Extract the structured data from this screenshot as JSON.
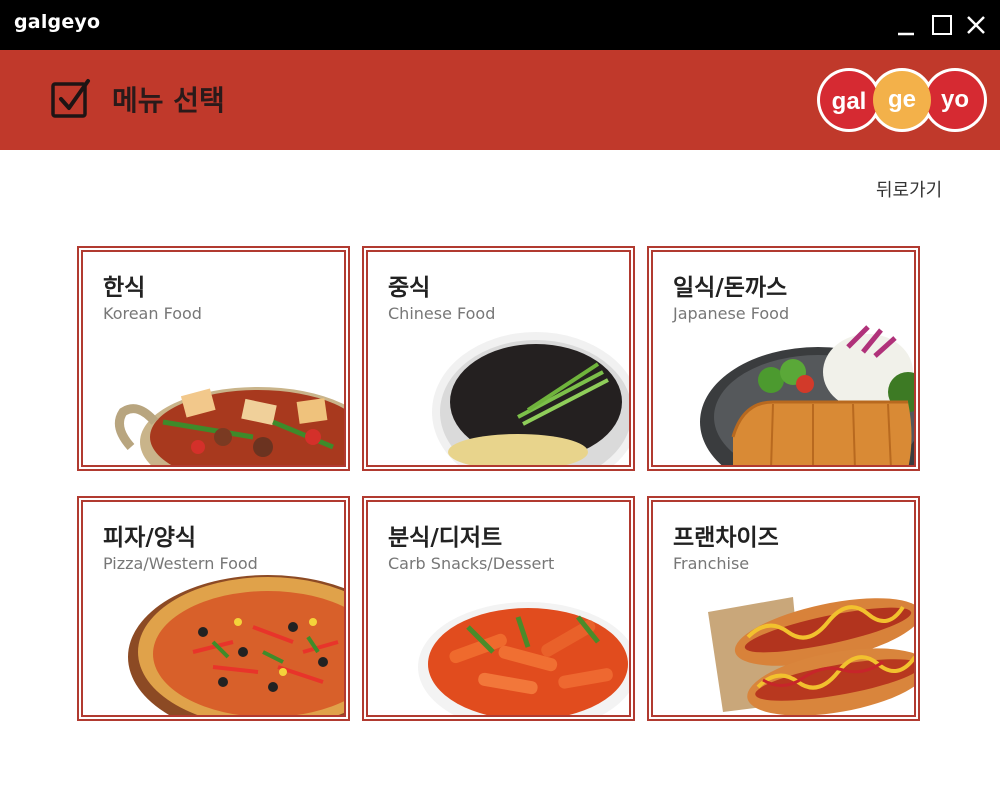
{
  "window": {
    "app_name": "galgeyo"
  },
  "header": {
    "title": "메뉴 선택",
    "logo": {
      "parts": [
        "gal",
        "ge",
        "yo"
      ]
    }
  },
  "nav": {
    "back_label": "뒤로가기"
  },
  "categories": [
    {
      "ko": "한식",
      "en": "Korean Food"
    },
    {
      "ko": "중식",
      "en": "Chinese Food"
    },
    {
      "ko": "일식/돈까스",
      "en": "Japanese Food"
    },
    {
      "ko": "피자/양식",
      "en": "Pizza/Western Food"
    },
    {
      "ko": "분식/디저트",
      "en": "Carb Snacks/Dessert"
    },
    {
      "ko": "프랜차이즈",
      "en": "Franchise"
    }
  ],
  "colors": {
    "header_bg": "#c0392b",
    "card_border": "#b13a30",
    "titlebar_bg": "#000000"
  }
}
